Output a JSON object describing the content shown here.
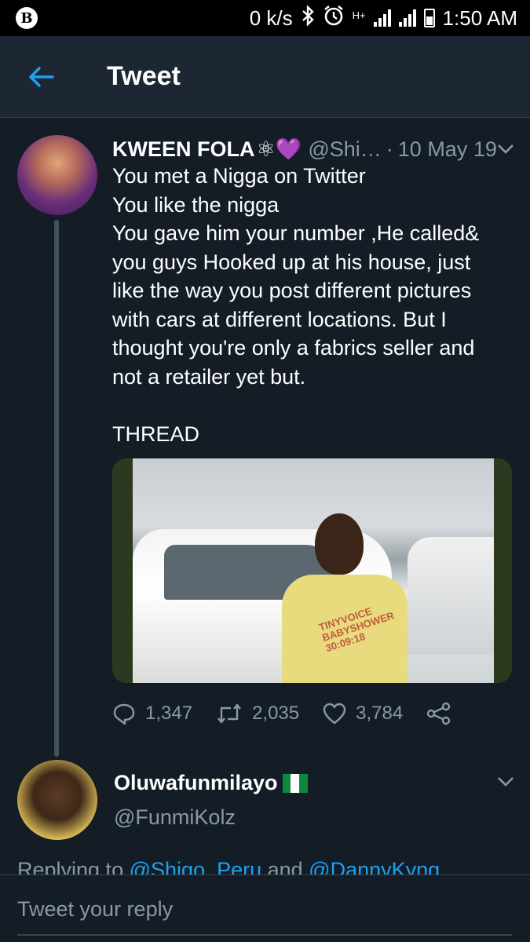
{
  "status_bar": {
    "logo": "B",
    "net_speed": "0 k/s",
    "network_type": "H+",
    "time": "1:50 AM",
    "icons": [
      "bluetooth-icon",
      "alarm-icon",
      "signal-icon",
      "battery-icon"
    ]
  },
  "header": {
    "title": "Tweet"
  },
  "tweet": {
    "name": "KWEEN FOLA",
    "name_emoji": "⚛",
    "name_heart": "💜",
    "handle": "@Shi…",
    "separator": "·",
    "date": "10 May 19",
    "text": "You met a Nigga on Twitter\nYou like the nigga\nYou gave him your number ,He called&\nyou guys Hooked up at his house, just\nlike the way you post different pictures\nwith cars at different locations. But I\nthought you're only a fabrics seller and\nnot a retailer yet but.\n\nTHREAD",
    "media_text": "TINYVOICE BABYSHOWER 30:09:18",
    "actions": {
      "replies": "1,347",
      "retweets": "2,035",
      "likes": "3,784"
    }
  },
  "reply": {
    "name": "Oluwafunmilayo",
    "handle": "@FunmiKolz",
    "replying_prefix": "Replying to ",
    "replying_to_1": "@Shigo_Peru",
    "replying_and": " and ",
    "replying_to_2": "@DannyKyng"
  },
  "compose": {
    "placeholder": "Tweet your reply"
  },
  "colors": {
    "background": "#141d26",
    "header": "#1c2733",
    "accent": "#1da1f2",
    "muted": "#8899a6",
    "divider": "#38444d"
  }
}
